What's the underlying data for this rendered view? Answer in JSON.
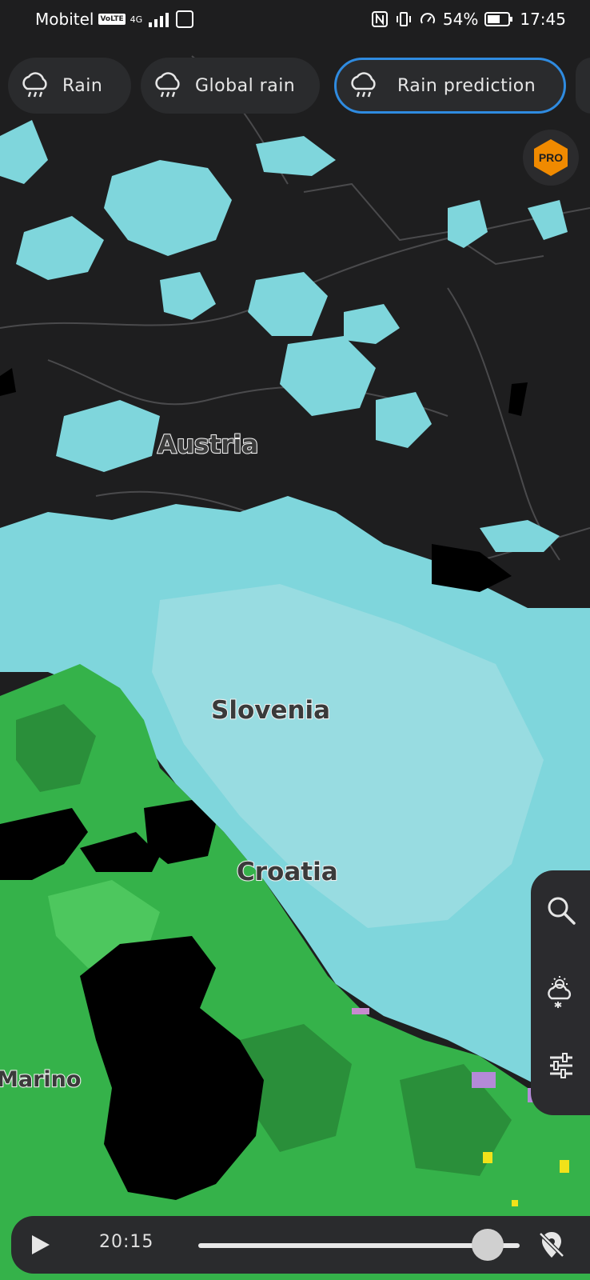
{
  "status_bar": {
    "carrier": "Mobitel",
    "volte": "VoLTE",
    "network": "4G",
    "battery": "54%",
    "time": "17:45"
  },
  "layer_chips": [
    {
      "label": "Rain",
      "icon": "rain-cloud-icon",
      "active": false
    },
    {
      "label": "Global rain",
      "icon": "rain-cloud-icon",
      "active": false
    },
    {
      "label": "Rain prediction",
      "icon": "rain-cloud-icon",
      "active": true
    }
  ],
  "pro_badge": "PRO",
  "map_labels": {
    "austria": "Austria",
    "slovenia": "Slovenia",
    "croatia": "Croatia",
    "marino": "Marino"
  },
  "side_panel": {
    "icons": [
      "search-icon",
      "weather-snow-cloud-icon",
      "sliders-icon"
    ]
  },
  "player": {
    "time": "20:15",
    "progress": 0.9
  },
  "colors": {
    "accent": "#2f8be0",
    "pro_orange": "#f08a00",
    "rain_light": "#7fd6dc",
    "rain_green": "#35b24a",
    "map_bg": "#1e1e1f"
  }
}
